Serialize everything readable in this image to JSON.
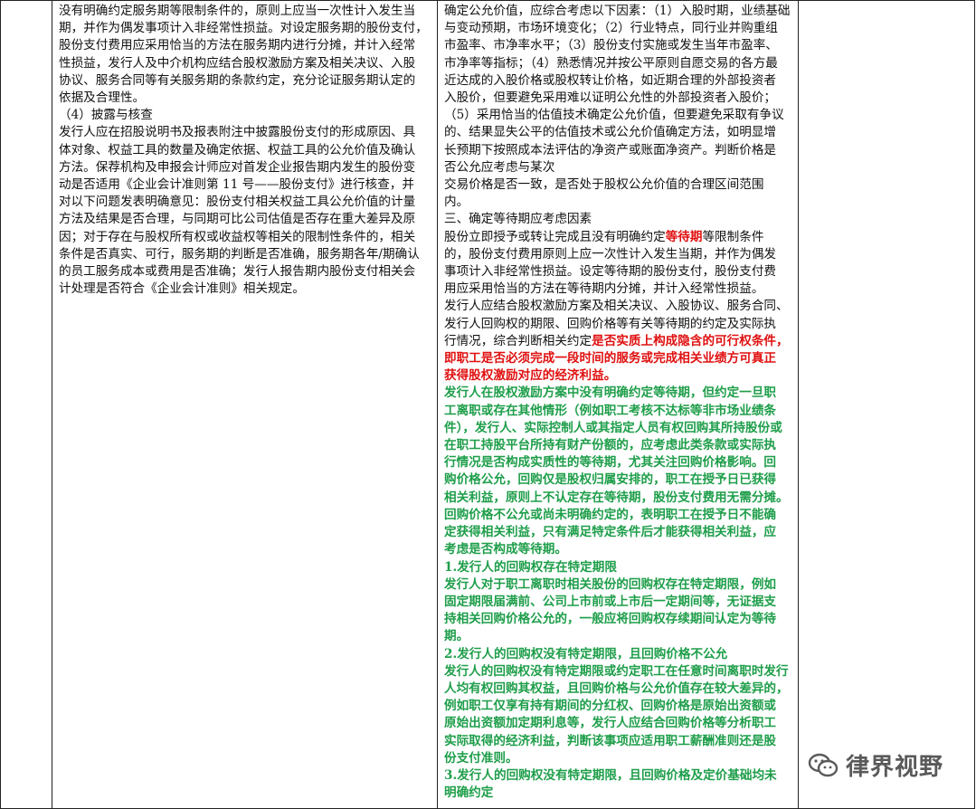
{
  "left_column": {
    "lines": [
      "没有明确约定服务期等限制条件的，原则上应当一次性计入发生当",
      "期，并作为偶发事项计入非经常性损益。对设定服务期的股份支付，",
      "股份支付费用应采用恰当的方法在服务期内进行分摊，并计入经常",
      "性损益，发行人及中介机构应结合股权激励方案及相关决议、入股",
      "协议、服务合同等有关服务期的条款约定，充分论证服务期认定的",
      "依据及合理性。",
      "（4）披露与核查",
      "发行人应在招股说明书及报表附注中披露股份支付的形成原因、具",
      "体对象、权益工具的数量及确定依据、权益工具的公允价值及确认",
      "方法。保荐机构及申报会计师应对首发企业报告期内发生的股份变",
      "动是否适用《企业会计准则第 11 号——股份支付》进行核查，并",
      "对以下问题发表明确意见：股份支付相关权益工具公允价值的计量",
      "方法及结果是否合理，与同期可比公司估值是否存在重大差异及原",
      "因；对于存在与股权所有权或收益权等相关的限制性条件的，相关",
      "条件是否真实、可行，服务期的判断是否准确，服务期各年/期确认",
      "的员工服务成本或费用是否准确；发行人报告期内股份支付相关会",
      "计处理是否符合《企业会计准则》相关规定。"
    ]
  },
  "right_column": {
    "paragraph_a": [
      "确定公允价值，应综合考虑以下因素：（1）入股时期，业绩基础",
      "与变动预期，市场环境变化；（2）行业特点，同行业并购重组",
      "市盈率、市净率水平；（3）股份支付实施或发生当年市盈率、",
      "市净率等指标；（4）熟悉情况并按公平原则自愿交易的各方最",
      "近达成的入股价格或股权转让价格，如近期合理的外部投资者",
      "入股价，但要避免采用难以证明公允性的外部投资者入股价；",
      "（5）采用恰当的估值技术确定公允价值，但要避免采取有争议",
      "的、结果显失公平的估值技术或公允价值确定方法，如明显增",
      "长预期下按照成本法评估的净资产或账面净资产。判断价格是",
      "否公允应考虑与某次",
      "交易价格是否一致，是否处于股权公允价值的合理区间范围",
      "内。"
    ],
    "section_heading": "三、确定等待期应考虑因素",
    "waiting_line1_before": "股份立即授予或转让完成且没有明确约定",
    "waiting_line1_highlight": "等待期",
    "waiting_line1_after": "等限制条件",
    "paragraph_b": [
      "的，股份支付费用原则上应一次性计入发生当期，并作为偶发",
      "事项计入非经常性损益。设定等待期的股份支付，股份支付费",
      "用应采用恰当的方法在等待期内分摊，并计入经常性损益。",
      "发行人应结合股权激励方案及相关决议、入股协议、服务合同、",
      "发行人回购权的期限、回购价格等有关等待期的约定及实际执"
    ],
    "mixed_line_before": "行情况，综合判断相关约定",
    "mixed_line_red": "是否实质上构成隐含的可行权条件，",
    "red_lines": [
      "即职工是否必须完成一段时间的服务或完成相关业绩方可真正",
      "获得股权激励对应的经济利益。"
    ],
    "green_lines": [
      "发行人在股权激励方案中没有明确约定等待期，但约定一旦职",
      "工离职或存在其他情形（例如职工考核不达标等非市场业绩条",
      "件），发行人、实际控制人或其指定人员有权回购其所持股份或",
      "在职工持股平台所持有财产份额的，应考虑此类条款或实际执",
      "行情况是否构成实质性的等待期，尤其关注回购价格影响。回",
      "购价格公允，回购仅是股权归属安排的，职工在授予日已获得",
      "相关利益，原则上不认定存在等待期，股份支付费用无需分摊。",
      "回购价格不公允或尚未明确约定的，表明职工在授予日不能确",
      "定获得相关利益，只有满足特定条件后才能获得相关利益，应",
      "考虑是否构成等待期。",
      "1.发行人的回购权存在特定期限",
      "发行人对于职工离职时相关股份的回购权存在特定期限，例如",
      "固定期限届满前、公司上市前或上市后一定期间等，无证据支",
      "持相关回购价格公允的，一般应将回购权存续期间认定为等待",
      "期。",
      "2.发行人的回购权没有特定期限，且回购价格不公允",
      "发行人的回购权没有特定期限或约定职工在任意时间离职时发行",
      "人均有权回购其权益，且回购价格与公允价值存在较大差异的，",
      "例如职工仅享有持有期间的分红权、回购价格是原始出资额或",
      "原始出资额加定期利息等，发行人应结合回购价格等分析职工",
      "实际取得的经济利益，判断该事项应适用职工薪酬准则还是股",
      "份支付准则。",
      "3.发行人的回购权没有特定期限，且回购价格及定价基础均未",
      "明确约定"
    ]
  },
  "watermark": {
    "text": "律界视野",
    "icon": "wechat-icon"
  },
  "colors": {
    "highlight_red": "#e01010",
    "highlight_green": "#1e9e4a",
    "watermark_gray": "#5a5a5a"
  }
}
